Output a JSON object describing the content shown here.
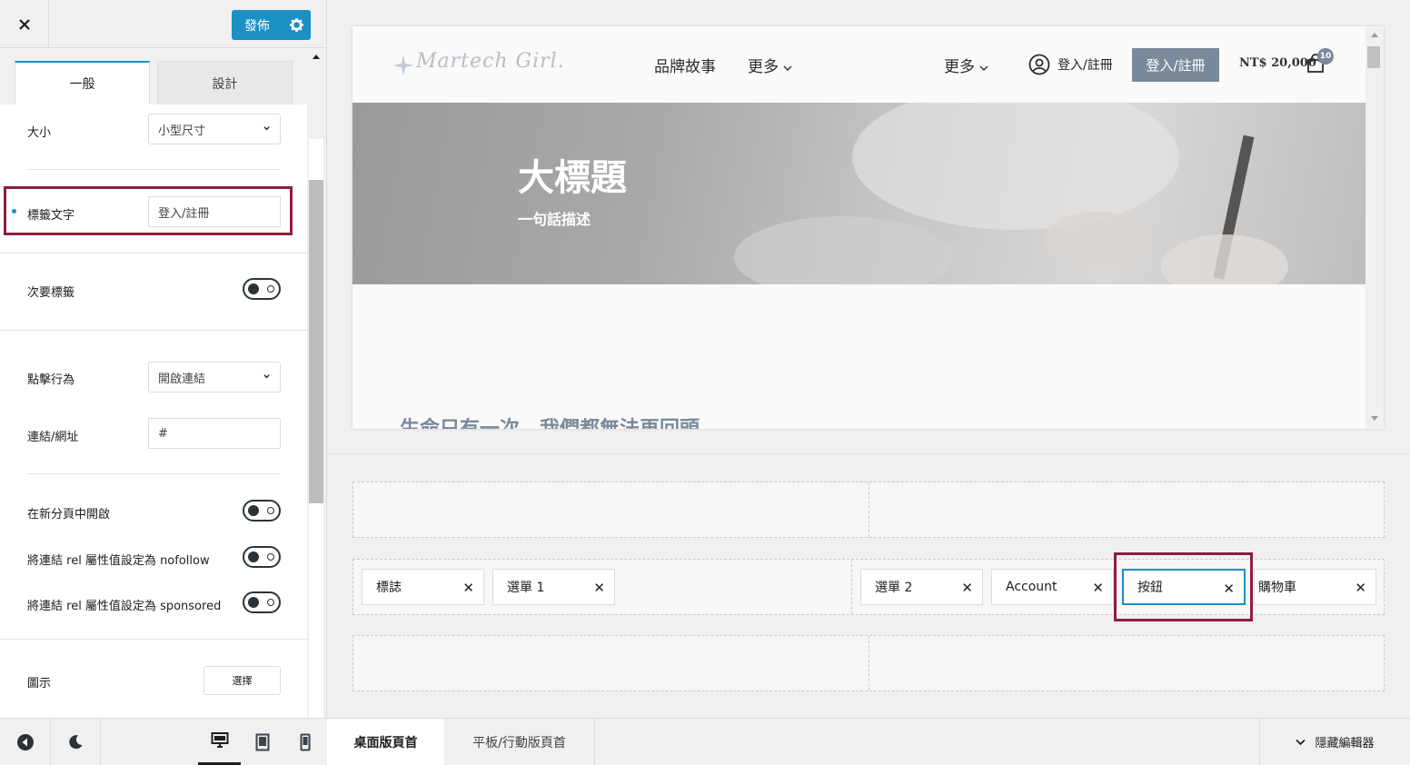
{
  "panel": {
    "publish_label": "發佈",
    "tabs": [
      "一般",
      "設計"
    ],
    "size": {
      "label": "大小",
      "value": "小型尺寸"
    },
    "label_text": {
      "label": "標籤文字",
      "value": "登入/註冊"
    },
    "secondary_label": {
      "label": "次要標籤",
      "on": false
    },
    "click_action": {
      "label": "點擊行為",
      "value": "開啟連結"
    },
    "link_url": {
      "label": "連結/網址",
      "value": "#"
    },
    "new_tab": {
      "label": "在新分頁中開啟",
      "on": false
    },
    "nofollow": {
      "label": "將連結 rel 屬性值設定為 nofollow",
      "on": false
    },
    "sponsored": {
      "label": "將連結 rel 屬性值設定為 sponsored",
      "on": false
    },
    "icon": {
      "label": "圖示",
      "button": "選擇"
    }
  },
  "bottom_bar": {
    "desktop_tab": "桌面版頁首",
    "mobile_tab": "平板/行動版頁首",
    "hide_editor": "隱藏編輯器"
  },
  "preview": {
    "logo": "Martech Girl.",
    "nav": [
      "品牌故事",
      "更多",
      "更多"
    ],
    "account_label": "登入/註冊",
    "signup_button": "登入/註冊",
    "price": "NT$ 20,000",
    "cart_count": "10",
    "hero_title": "大標題",
    "hero_subtitle": "一句話描述",
    "body_heading": "生命只有一次，我們都無法再回頭"
  },
  "builder": {
    "left_chips": [
      "標誌",
      "選單 1"
    ],
    "right_chips": [
      "選單 2",
      "Account",
      "按鈕",
      "購物車"
    ]
  },
  "colors": {
    "accent": "#1c8fc4",
    "highlight": "#8f1d3d",
    "brand": "#7a8a9c"
  }
}
